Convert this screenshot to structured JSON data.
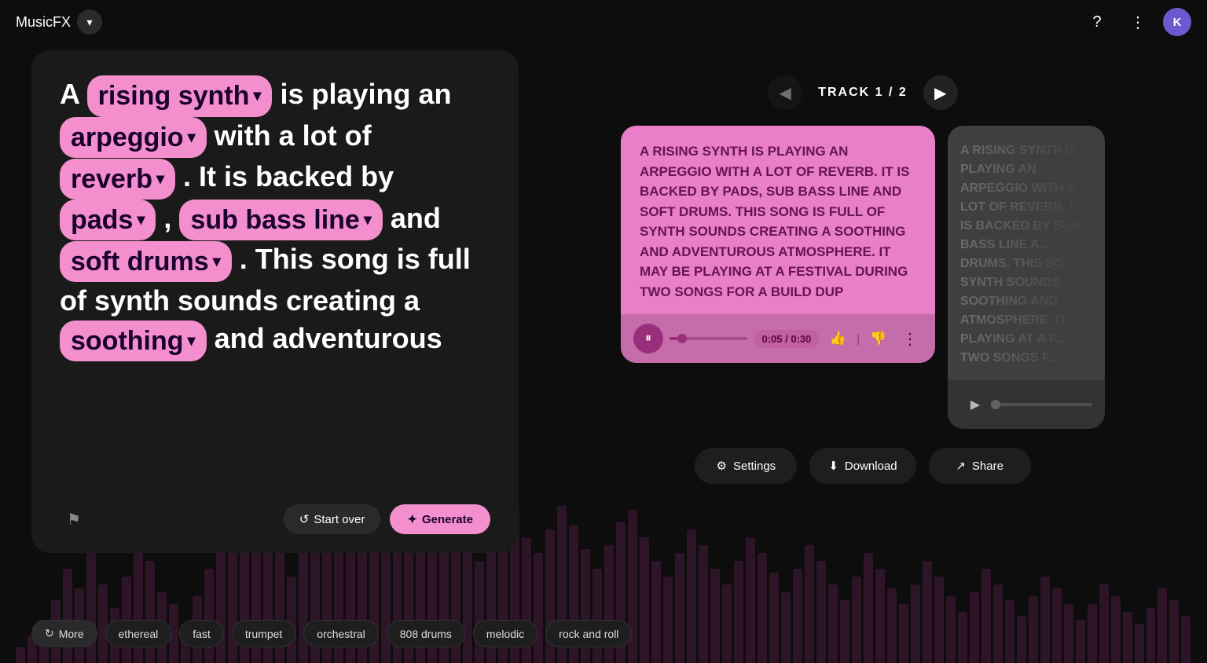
{
  "app": {
    "title": "MusicFX",
    "avatar_initial": "K"
  },
  "prompt": {
    "parts": [
      {
        "type": "text",
        "content": "A "
      },
      {
        "type": "chip",
        "content": "rising synth",
        "id": "chip-rising-synth"
      },
      {
        "type": "text",
        "content": " is playing an "
      },
      {
        "type": "chip",
        "content": "arpeggio",
        "id": "chip-arpeggio"
      },
      {
        "type": "text",
        "content": " with a lot of "
      },
      {
        "type": "chip",
        "content": "reverb",
        "id": "chip-reverb"
      },
      {
        "type": "text",
        "content": ". It is backed by "
      },
      {
        "type": "chip",
        "content": "pads",
        "id": "chip-pads"
      },
      {
        "type": "text",
        "content": ", "
      },
      {
        "type": "chip",
        "content": "sub bass line",
        "id": "chip-sub-bass"
      },
      {
        "type": "text",
        "content": " and "
      },
      {
        "type": "chip",
        "content": "soft drums",
        "id": "chip-soft-drums"
      },
      {
        "type": "text",
        "content": ". This song is full of synth sounds creating a "
      },
      {
        "type": "chip",
        "content": "soothing",
        "id": "chip-soothing"
      },
      {
        "type": "text",
        "content": " and adventurous"
      }
    ],
    "start_over_label": "Start over",
    "generate_label": "Generate"
  },
  "suggestions": {
    "more_label": "More",
    "items": [
      "ethereal",
      "fast",
      "trumpet",
      "orchestral",
      "808 drums",
      "melodic",
      "rock and roll"
    ]
  },
  "tracks": {
    "label": "TRACK",
    "current": 1,
    "total": 2,
    "active": {
      "lyrics": "A RISING SYNTH IS PLAYING AN ARPEGGIO WITH A LOT OF REVERB. IT IS BACKED BY PADS, SUB BASS LINE AND SOFT DRUMS. THIS SONG IS FULL OF SYNTH SOUNDS CREATING A SOOTHING AND ADVENTUROUS ATMOSPHERE. IT MAY BE PLAYING AT A FESTIVAL DURING TWO SONGS FOR A BUILD DUP",
      "progress_pct": 17,
      "time_current": "0:05",
      "time_total": "0:30",
      "is_playing": true
    },
    "inactive": {
      "lyrics": "A RISING SYNTH IS PLAYING AN ARPEGGIO WITH A LOT OF REVERB. IT IS BACKED BY SUB BASS LINE A... DRUMS. THIS SO... SYNTH SOUNDS SOOTHING AND ATMOSPHERE. IT PLAYING AT A F... TWO SONGS F...",
      "progress_pct": 0,
      "time_current": "",
      "time_total": "",
      "is_playing": false
    }
  },
  "actions": {
    "settings_label": "Settings",
    "download_label": "Download",
    "share_label": "Share"
  },
  "waveform_heights": [
    20,
    35,
    55,
    80,
    120,
    95,
    140,
    100,
    70,
    110,
    160,
    130,
    90,
    75,
    50,
    85,
    120,
    145,
    180,
    155,
    200,
    170,
    140,
    110,
    180,
    220,
    190,
    160,
    210,
    240,
    200,
    170,
    190,
    220,
    185,
    150,
    175,
    200,
    160,
    130,
    180,
    210,
    195,
    160,
    140,
    170,
    200,
    175,
    145,
    120,
    150,
    180,
    195,
    160,
    130,
    110,
    140,
    170,
    150,
    120,
    100,
    130,
    160,
    140,
    115,
    90,
    120,
    150,
    130,
    100,
    80,
    110,
    140,
    120,
    95,
    75,
    100,
    130,
    110,
    85,
    65,
    90,
    120,
    100,
    80,
    60,
    85,
    110,
    95,
    75,
    55,
    75,
    100,
    85,
    65,
    50,
    70,
    95,
    80,
    60
  ]
}
